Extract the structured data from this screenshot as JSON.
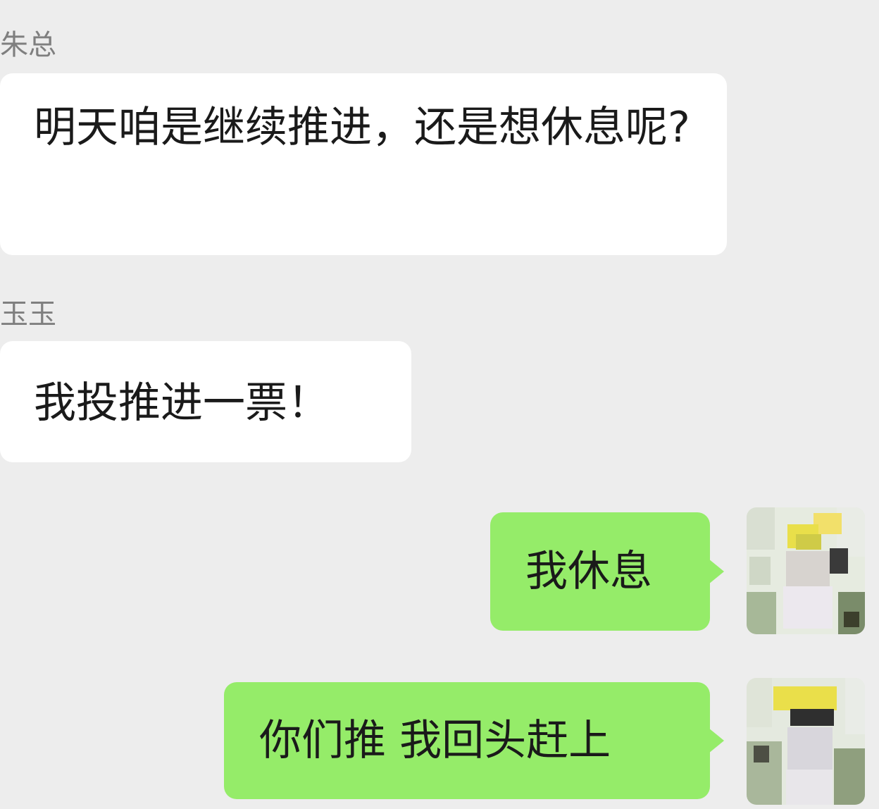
{
  "chat": {
    "messages": [
      {
        "sender": "朱总",
        "text": "明天咱是继续推进，还是想休息呢?",
        "direction": "incoming"
      },
      {
        "sender": "玉玉",
        "text": "我投推进一票！",
        "direction": "incoming"
      },
      {
        "text": "我休息",
        "direction": "outgoing",
        "avatar": "pixelated-avatar-icon"
      },
      {
        "text": "你们推 我回头赶上",
        "direction": "outgoing",
        "avatar": "pixelated-avatar-icon"
      }
    ]
  },
  "colors": {
    "background": "#ededed",
    "incoming_bubble": "#ffffff",
    "outgoing_bubble": "#95ec69",
    "sender_name": "#7f7f7f",
    "message_text": "#1a1a1a"
  }
}
